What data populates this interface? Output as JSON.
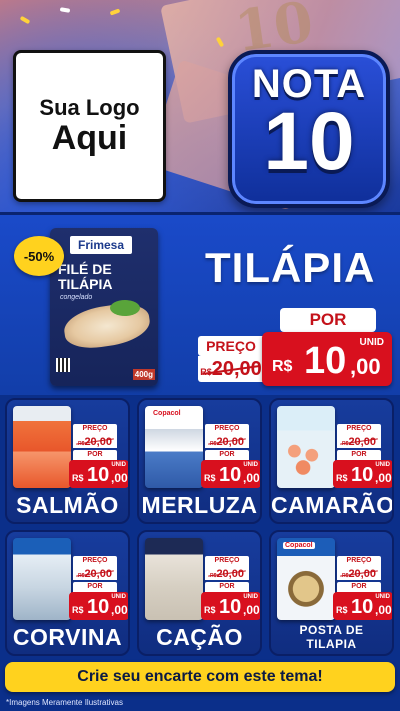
{
  "header": {
    "logo_line1": "Sua Logo",
    "logo_line2": "Aqui",
    "badge_word": "NOTA",
    "badge_number": "10"
  },
  "featured": {
    "discount": "-50%",
    "package_brand": "Frimesa",
    "package_title_line1": "FILÉ DE",
    "package_title_line2": "TILÁPIA",
    "package_subtitle": "congelado",
    "package_weight": "400g",
    "name": "TILÁPIA",
    "preco_label": "PREÇO",
    "por_label": "POR",
    "unid_label": "UNID",
    "old_currency": "R$",
    "old_price": "20,00",
    "new_currency": "R$",
    "new_price_int": "10",
    "new_price_dec": ",00"
  },
  "labels": {
    "preco": "PREÇO",
    "por": "POR",
    "unid": "UNID",
    "currency": "R$",
    "old_price": "20,00",
    "new_int": "10",
    "new_dec": ",00"
  },
  "products": [
    {
      "name": "SALMÃO",
      "brand": ""
    },
    {
      "name": "MERLUZA",
      "brand": "Copacol"
    },
    {
      "name": "CAMARÃO",
      "brand": ""
    },
    {
      "name": "CORVINA",
      "brand": ""
    },
    {
      "name": "CAÇÃO",
      "brand": ""
    },
    {
      "name": "POSTA DE TILAPIA",
      "brand": "Copacol"
    }
  ],
  "footer": {
    "cta": "Crie seu encarte com este tema!",
    "disclaimer": "*Imagens Meramente Ilustrativas"
  },
  "colors": {
    "background": "#0b2f8a",
    "price_red": "#d8101e",
    "accent_yellow": "#ffd21e"
  }
}
